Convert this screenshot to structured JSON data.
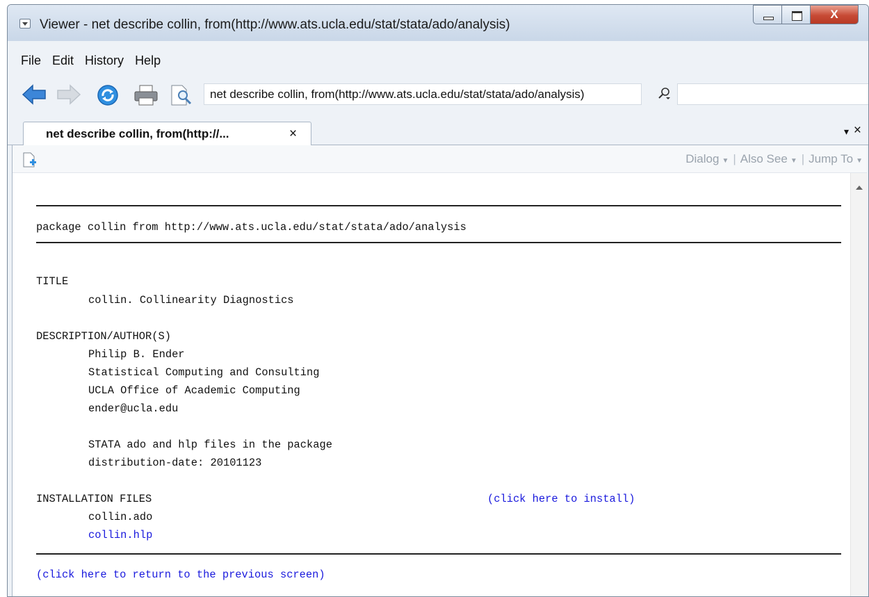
{
  "window": {
    "title": "Viewer - net describe collin, from(http://www.ats.ucla.edu/stat/stata/ado/analysis)",
    "close_glyph": "X"
  },
  "menubar": {
    "items": [
      "File",
      "Edit",
      "History",
      "Help"
    ]
  },
  "toolbar": {
    "address_value": "net describe collin, from(http://www.ats.ucla.edu/stat/stata/ado/analysis)",
    "icons": [
      "back-arrow-icon",
      "forward-arrow-icon",
      "refresh-icon",
      "print-icon",
      "find-icon",
      "search-icon"
    ]
  },
  "tab": {
    "label": "net describe collin, from(http://...",
    "close_glyph": "×",
    "menu_glyph": "▾",
    "close_all_glyph": "×"
  },
  "viewer_toolbar": {
    "dialog": "Dialog",
    "also_see": "Also See",
    "jump_to": "Jump To",
    "caret": "▼",
    "separator": "|"
  },
  "content": {
    "package_line": "package collin from http://www.ats.ucla.edu/stat/stata/ado/analysis",
    "title_heading": "TITLE",
    "title_text": "collin. Collinearity Diagnostics",
    "description_heading": "DESCRIPTION/AUTHOR(S)",
    "description_lines": [
      "Philip B. Ender",
      "Statistical Computing and Consulting",
      "UCLA Office of Academic Computing",
      "ender@ucla.edu",
      "STATA ado and hlp files in the package",
      "distribution-date: 20101123"
    ],
    "installation_heading": "INSTALLATION FILES",
    "install_link": "(click here to install)",
    "files": [
      "collin.ado",
      "collin.hlp"
    ],
    "return_link": "(click here to return to the previous screen)"
  },
  "colors": {
    "link": "#1a1add",
    "close_button": "#c74a35"
  }
}
